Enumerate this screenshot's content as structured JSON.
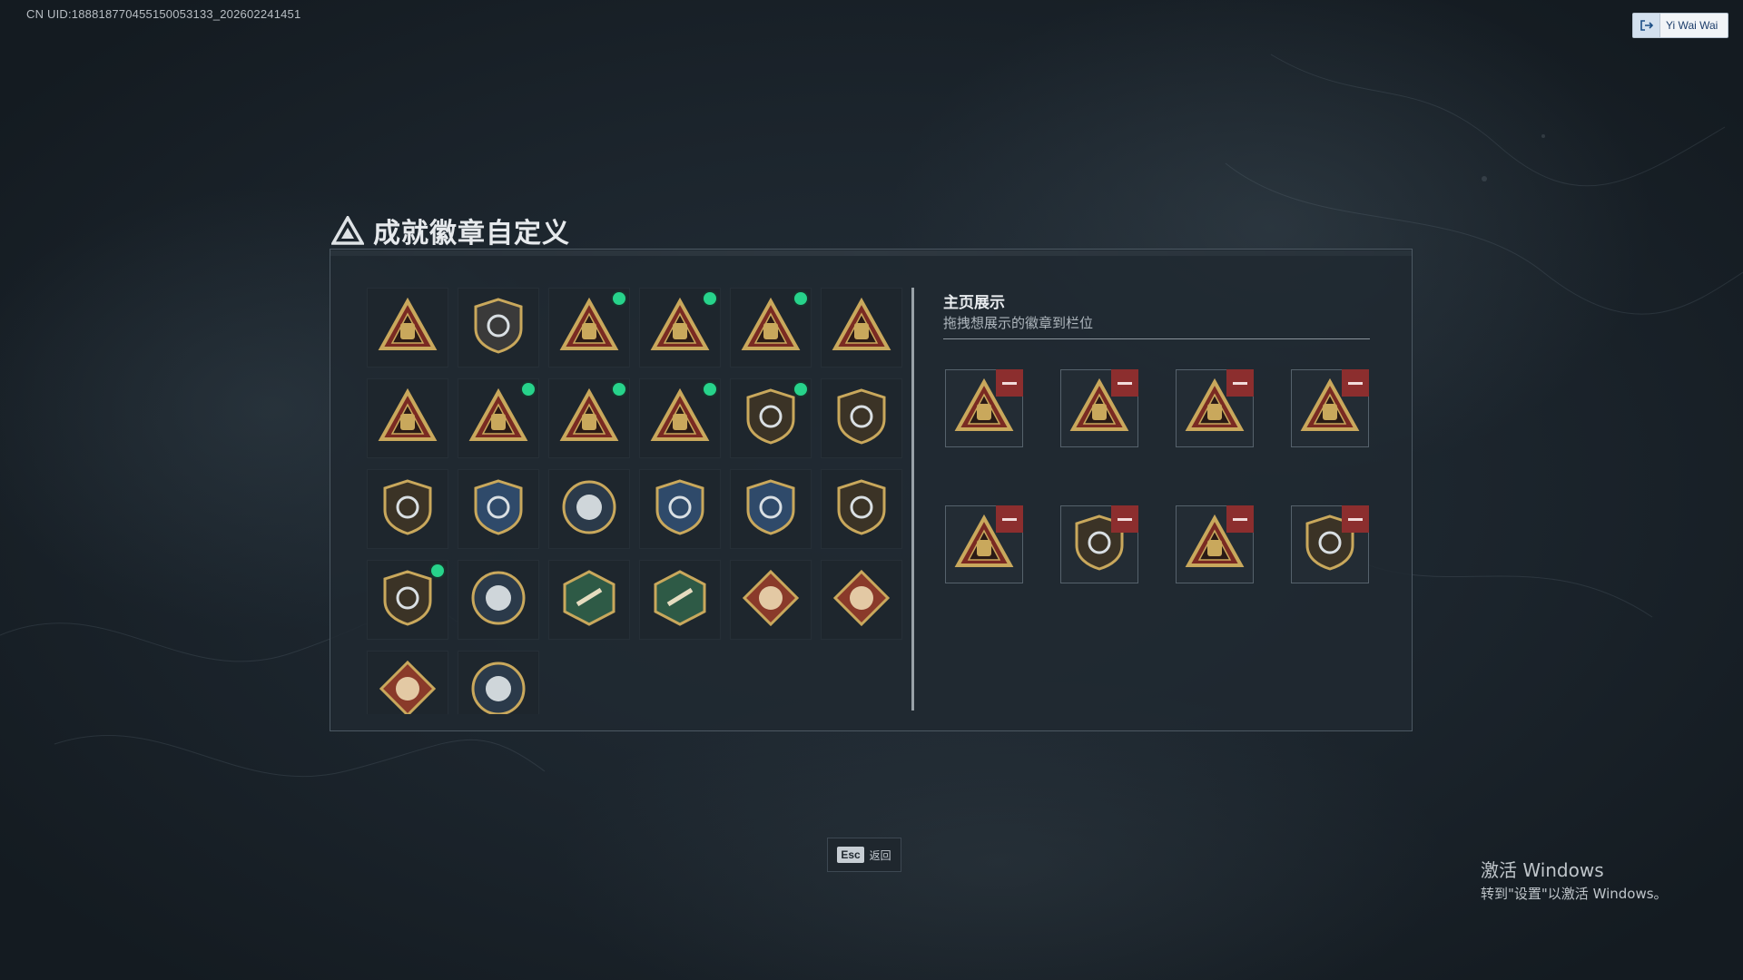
{
  "header": {
    "uid_text": "CN UID:1888187704551500531​33_202602241451",
    "user_name": "Yi Wai Wai"
  },
  "dialog": {
    "title": "成就徽章自定义",
    "inventory": [
      {
        "badge": "shield-triangle-badge",
        "new": false
      },
      {
        "badge": "helicopter-badge",
        "new": false
      },
      {
        "badge": "season-s4-badge",
        "new": true
      },
      {
        "badge": "season-s5-badge",
        "new": true
      },
      {
        "badge": "season-s6-badge",
        "new": true
      },
      {
        "badge": "season-s8-badge",
        "new": false
      },
      {
        "badge": "rank-1-badge",
        "new": false
      },
      {
        "badge": "supply-crate-badge",
        "new": true
      },
      {
        "badge": "soldier-triangle-badge",
        "new": true
      },
      {
        "badge": "rocket-triangle-badge",
        "new": true
      },
      {
        "badge": "star-wreath-badge",
        "new": true
      },
      {
        "badge": "chevron-shield-badge",
        "new": false
      },
      {
        "badge": "crest-gold-badge",
        "new": false
      },
      {
        "badge": "crest-blue-badge",
        "new": false
      },
      {
        "badge": "sniper-circle-badge",
        "new": false
      },
      {
        "badge": "target-shield-badge",
        "new": false
      },
      {
        "badge": "target-shield-2-badge",
        "new": false
      },
      {
        "badge": "compass-shield-badge",
        "new": false
      },
      {
        "badge": "rifles-crest-badge",
        "new": true
      },
      {
        "badge": "eagle-circle-badge",
        "new": false
      },
      {
        "badge": "wasp-hex-badge",
        "new": false
      },
      {
        "badge": "weapon-hex-badge",
        "new": false
      },
      {
        "badge": "dragon-diamond-badge",
        "new": false
      },
      {
        "badge": "dragon-diamond-2-badge",
        "new": false
      },
      {
        "badge": "runner-diamond-badge",
        "new": false
      },
      {
        "badge": "wolf-circle-badge",
        "new": false
      }
    ],
    "showcase": {
      "title": "主页展示",
      "subtitle": "拖拽想展示的徽章到栏位",
      "slots": [
        "supply-crate-badge",
        "season-s4-badge",
        "season-s5-badge",
        "season-s6-badge",
        "soldier-triangle-badge",
        "rifles-crest-badge",
        "rocket-triangle-badge",
        "star-wreath-badge"
      ]
    }
  },
  "footer": {
    "esc_key": "Esc",
    "esc_label": "返回"
  },
  "windows_watermark": {
    "line1": "激活 Windows",
    "line2": "转到\"设置\"以激活 Windows。"
  },
  "colors": {
    "new_dot": "#27d38b",
    "remove": "#8c2e2e",
    "gold": "#c9a85c",
    "red": "#7a2a22"
  }
}
